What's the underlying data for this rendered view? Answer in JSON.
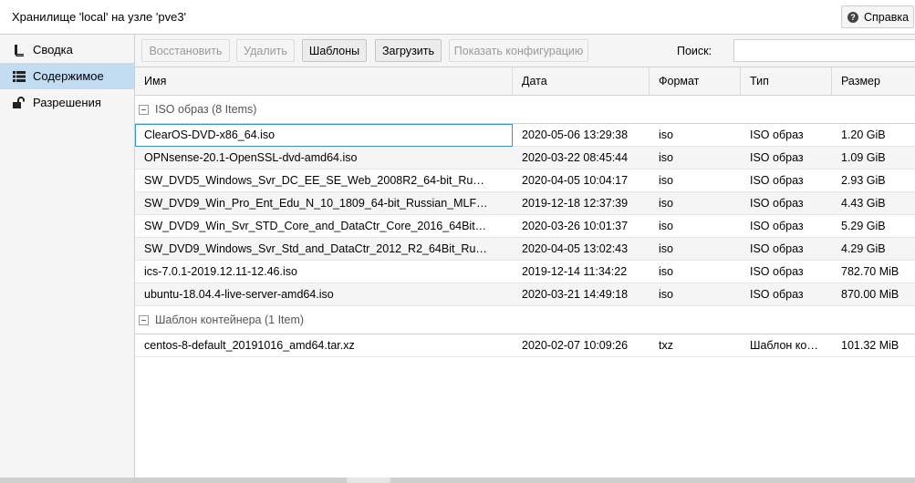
{
  "window": {
    "title": "Хранилище 'local' на узле 'pve3'",
    "help_label": "Справка"
  },
  "sidebar": {
    "items": [
      {
        "label": "Сводка",
        "icon": "book-icon",
        "active": false
      },
      {
        "label": "Содержимое",
        "icon": "grid-icon",
        "active": true
      },
      {
        "label": "Разрешения",
        "icon": "unlock-icon",
        "active": false
      }
    ]
  },
  "toolbar": {
    "restore_label": "Восстановить",
    "delete_label": "Удалить",
    "templates_label": "Шаблоны",
    "upload_label": "Загрузить",
    "show_config_label": "Показать конфигурацию",
    "search_label": "Поиск:",
    "search_value": "",
    "search_placeholder": ""
  },
  "grid": {
    "columns": [
      "Имя",
      "Дата",
      "Формат",
      "Тип",
      "Размер"
    ],
    "groups": [
      {
        "label": "ISO образ (8 Items)",
        "rows": [
          {
            "name": "ClearOS-DVD-x86_64.iso",
            "date": "2020-05-06 13:29:38",
            "format": "iso",
            "type": "ISO образ",
            "size": "1.20 GiB"
          },
          {
            "name": "OPNsense-20.1-OpenSSL-dvd-amd64.iso",
            "date": "2020-03-22 08:45:44",
            "format": "iso",
            "type": "ISO образ",
            "size": "1.09 GiB"
          },
          {
            "name": "SW_DVD5_Windows_Svr_DC_EE_SE_Web_2008R2_64-bit_Ru…",
            "date": "2020-04-05 10:04:17",
            "format": "iso",
            "type": "ISO образ",
            "size": "2.93 GiB"
          },
          {
            "name": "SW_DVD9_Win_Pro_Ent_Edu_N_10_1809_64-bit_Russian_MLF…",
            "date": "2019-12-18 12:37:39",
            "format": "iso",
            "type": "ISO образ",
            "size": "4.43 GiB"
          },
          {
            "name": "SW_DVD9_Win_Svr_STD_Core_and_DataCtr_Core_2016_64Bit…",
            "date": "2020-03-26 10:01:37",
            "format": "iso",
            "type": "ISO образ",
            "size": "5.29 GiB"
          },
          {
            "name": "SW_DVD9_Windows_Svr_Std_and_DataCtr_2012_R2_64Bit_Ru…",
            "date": "2020-04-05 13:02:43",
            "format": "iso",
            "type": "ISO образ",
            "size": "4.29 GiB"
          },
          {
            "name": "ics-7.0.1-2019.12.11-12.46.iso",
            "date": "2019-12-14 11:34:22",
            "format": "iso",
            "type": "ISO образ",
            "size": "782.70 MiB"
          },
          {
            "name": "ubuntu-18.04.4-live-server-amd64.iso",
            "date": "2020-03-21 14:49:18",
            "format": "iso",
            "type": "ISO образ",
            "size": "870.00 MiB"
          }
        ]
      },
      {
        "label": "Шаблон контейнера (1 Item)",
        "rows": [
          {
            "name": "centos-8-default_20191016_amd64.tar.xz",
            "date": "2020-02-07 10:09:26",
            "format": "txz",
            "type": "Шаблон ко…",
            "size": "101.32 MiB"
          }
        ]
      }
    ]
  },
  "colors": {
    "selected_sidebar": "#c2ddf2",
    "focus_outline": "#3892d4",
    "panel_bg": "#f5f5f5",
    "border": "#cfcfcf"
  }
}
